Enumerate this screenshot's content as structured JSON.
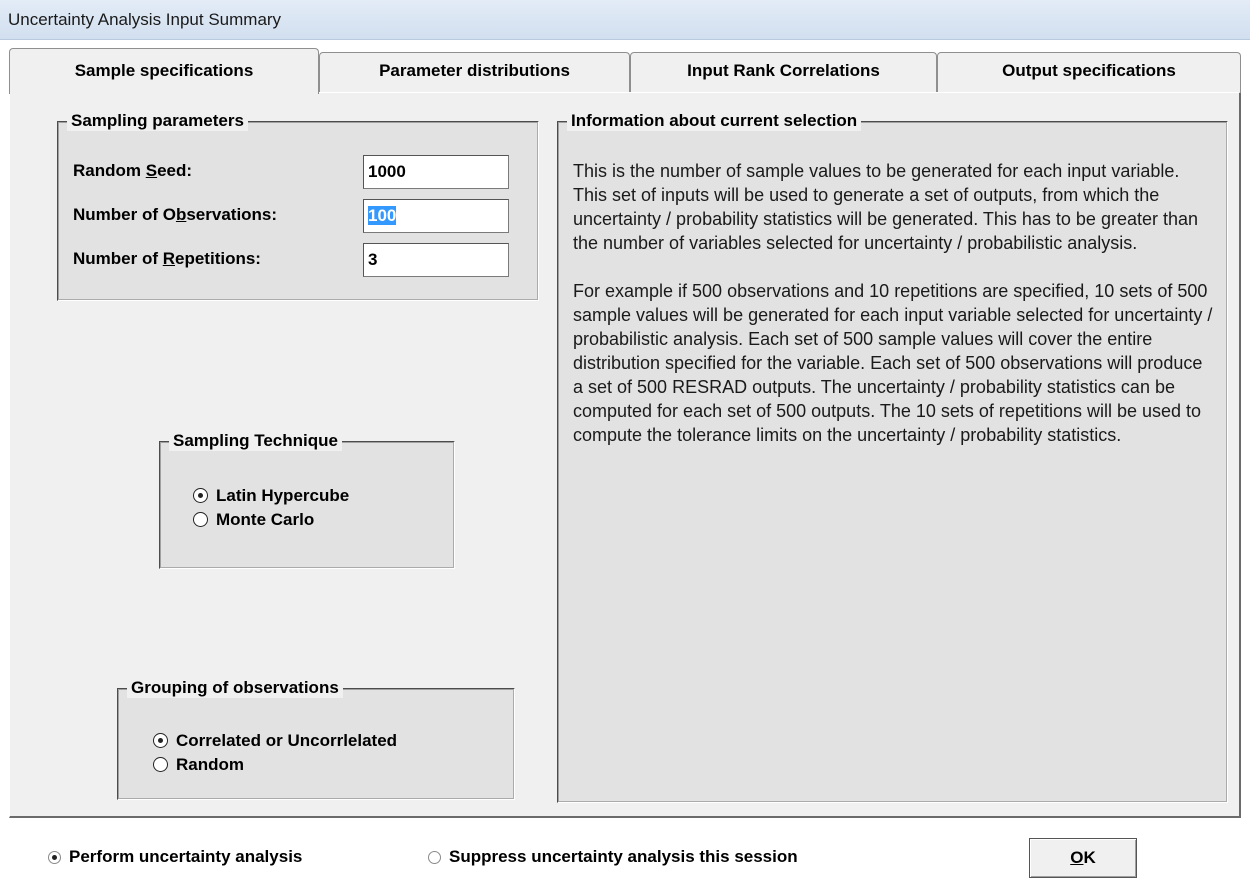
{
  "window": {
    "title": "Uncertainty Analysis Input Summary"
  },
  "tabs": [
    {
      "label": "Sample specifications",
      "active": true
    },
    {
      "label": "Parameter distributions",
      "active": false
    },
    {
      "label": "Input Rank Correlations",
      "active": false
    },
    {
      "label": "Output specifications",
      "active": false
    }
  ],
  "sampling_parameters": {
    "legend": "Sampling parameters",
    "random_seed": {
      "label_pre": "Random ",
      "label_key": "S",
      "label_post": "eed:",
      "value": "1000"
    },
    "observations": {
      "label_pre": "Number of O",
      "label_key": "b",
      "label_post": "servations:",
      "value": "100"
    },
    "repetitions": {
      "label_pre": "Number of ",
      "label_key": "R",
      "label_post": "epetitions:",
      "value": "3"
    }
  },
  "sampling_technique": {
    "legend": "Sampling Technique",
    "options": [
      {
        "label": "Latin Hypercube",
        "selected": true
      },
      {
        "label": "Monte Carlo",
        "selected": false
      }
    ]
  },
  "grouping": {
    "legend": "Grouping of observations",
    "options": [
      {
        "label": "Correlated or Uncorrlelated",
        "selected": true
      },
      {
        "label": "Random",
        "selected": false
      }
    ]
  },
  "info": {
    "legend": "Information about current selection",
    "paragraph1": "This is the number of sample values to be generated for each input variable.  This set of inputs will be used to generate a set of outputs, from which the uncertainty / probability statistics will be generated.  This has to be greater than the number of variables selected for uncertainty / probabilistic analysis.",
    "paragraph2": "For example if 500 observations and 10 repetitions are specified, 10 sets of 500 sample values will be generated for each input variable selected for uncertainty / probabilistic analysis.  Each set of 500 sample values will cover the entire distribution specified for the variable. Each set of 500 observations will produce a set of 500 RESRAD outputs.  The uncertainty / probability statistics can be computed for each set of 500 outputs. The 10 sets of repetitions will be used to compute the tolerance limits on the uncertainty / probability statistics."
  },
  "footer": {
    "perform_label": "Perform uncertainty analysis",
    "perform_selected": true,
    "suppress_label": "Suppress uncertainty analysis this session",
    "suppress_selected": false,
    "ok_key": "O",
    "ok_rest": "K"
  }
}
